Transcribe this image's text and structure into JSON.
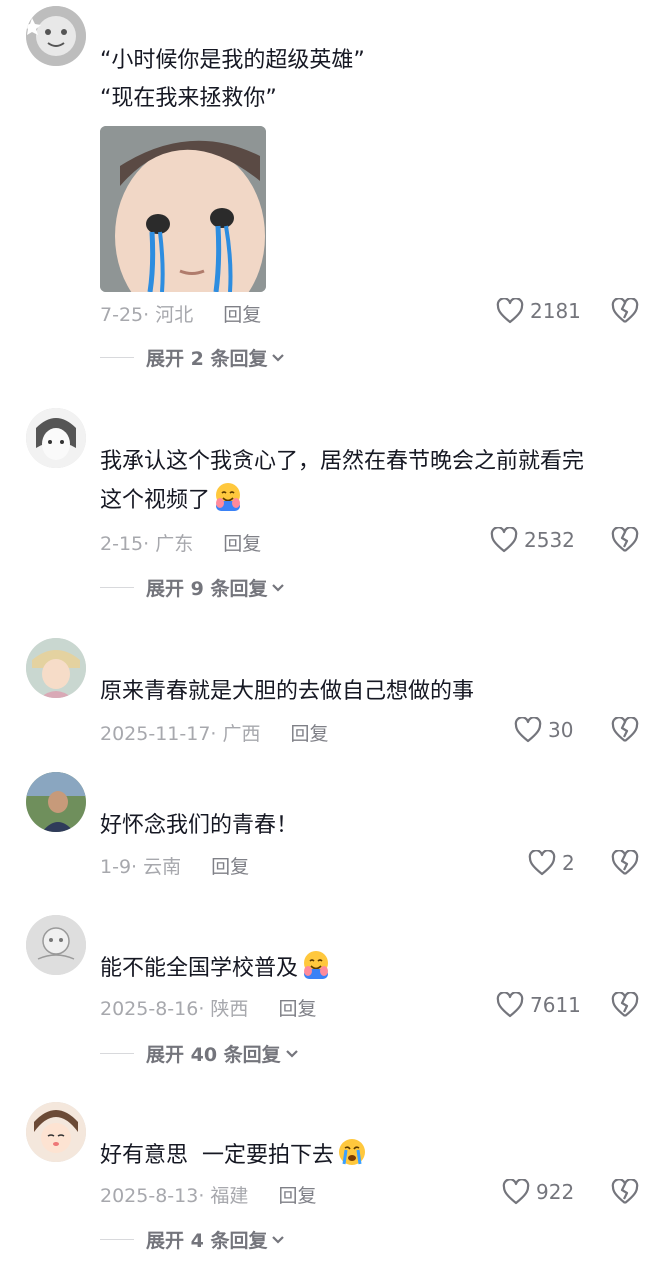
{
  "comments": [
    {
      "lines": [
        "“小时候你是我的超级英雄”",
        "“现在我来拯救你”"
      ],
      "date_location": "7-25· 河北",
      "reply": "回复",
      "likes": "2181",
      "expand": "展开 2 条回复"
    },
    {
      "lines": [
        "我承认这个我贪心了，居然在春节晚会之前就看完",
        "这个视频了"
      ],
      "date_location": "2-15· 广东",
      "reply": "回复",
      "likes": "2532",
      "expand": "展开 9 条回复"
    },
    {
      "lines": [
        "原来青春就是大胆的去做自己想做的事"
      ],
      "date_location": "2025-11-17· 广西",
      "reply": "回复",
      "likes": "30"
    },
    {
      "lines": [
        "好怀念我们的青春！"
      ],
      "date_location": "1-9· 云南",
      "reply": "回复",
      "likes": "2"
    },
    {
      "lines": [
        "能不能全国学校普及"
      ],
      "date_location": "2025-8-16· 陕西",
      "reply": "回复",
      "likes": "7611",
      "expand": "展开 40 条回复"
    },
    {
      "lines": [
        "好有意思  一定要拍下去"
      ],
      "date_location": "2025-8-13· 福建",
      "reply": "回复",
      "likes": "922",
      "expand": "展开 4 条回复"
    }
  ],
  "icons": {
    "like": "heart-outline-icon",
    "dislike": "broken-heart-icon",
    "expand": "chevron-down-icon",
    "hug_emoji": "hugging-face-emoji",
    "cry_emoji": "loudly-crying-face-emoji"
  },
  "colors": {
    "text": "#161823",
    "meta": "#a7a8ad",
    "action": "#74757c"
  }
}
